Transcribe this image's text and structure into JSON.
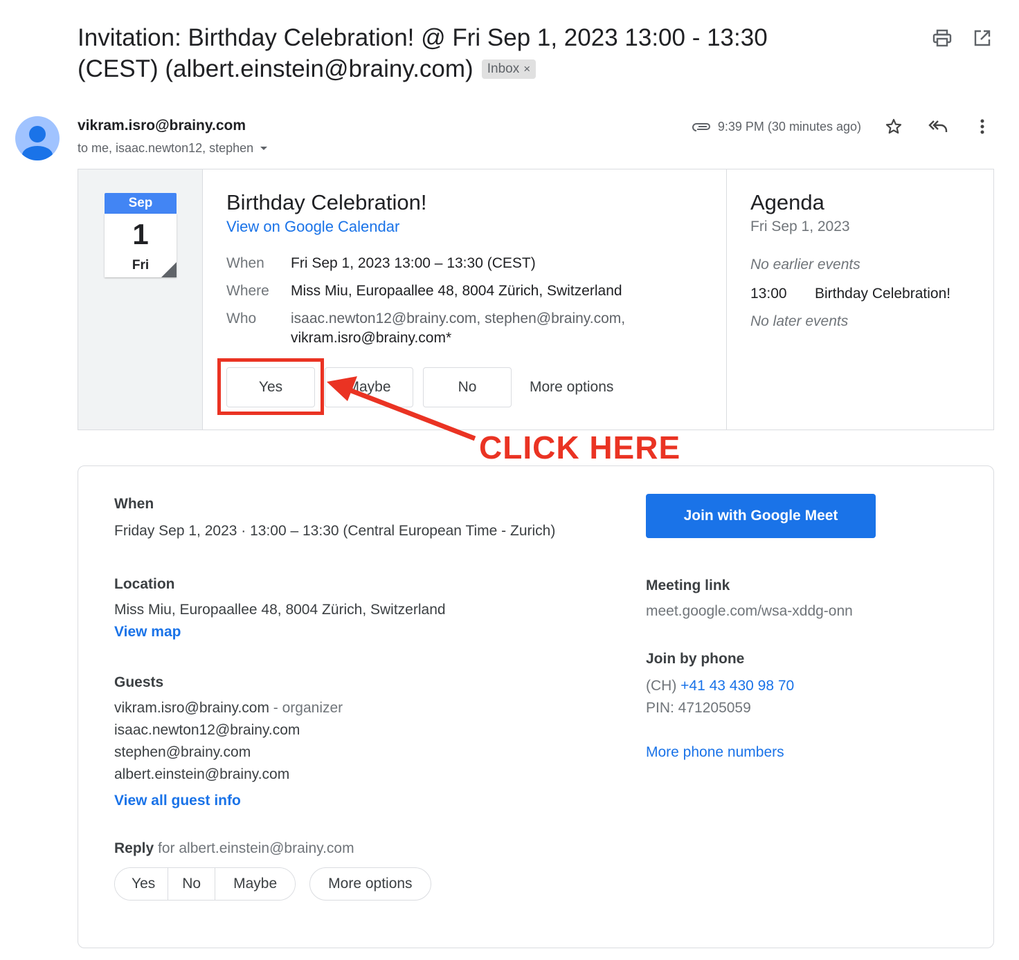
{
  "email": {
    "subject": "Invitation: Birthday Celebration! @ Fri Sep 1, 2023 13:00 - 13:30 (CEST) (albert.einstein@brainy.com)",
    "label": "Inbox",
    "label_close": "×",
    "sender": "vikram.isro@brainy.com",
    "recipients": "to me, isaac.newton12, stephen",
    "time": "9:39 PM (30 minutes ago)"
  },
  "invite": {
    "cal_month": "Sep",
    "cal_day": "1",
    "cal_dow": "Fri",
    "title": "Birthday Celebration!",
    "view_link": "View on Google Calendar",
    "when_label": "When",
    "when_value": "Fri Sep 1, 2023 13:00 – 13:30 (CEST)",
    "where_label": "Where",
    "where_value": "Miss Miu, Europaallee 48, 8004 Zürich, Switzerland",
    "who_label": "Who",
    "who_line1": "isaac.newton12@brainy.com, stephen@brainy.com,",
    "who_line2": "vikram.isro@brainy.com*",
    "rsvp": {
      "yes": "Yes",
      "maybe": "Maybe",
      "no": "No",
      "more": "More options"
    }
  },
  "agenda": {
    "title": "Agenda",
    "date": "Fri Sep 1, 2023",
    "no_earlier": "No earlier events",
    "event_time": "13:00",
    "event_title": "Birthday Celebration!",
    "no_later": "No later events"
  },
  "annotation": {
    "text": "CLICK HERE",
    "color": "#ea3323"
  },
  "description": {
    "when_heading": "When",
    "when_text": "Friday Sep 1, 2023 · 13:00 – 13:30 (Central European Time - Zurich)",
    "location_heading": "Location",
    "location_text": "Miss Miu, Europaallee 48, 8004 Zürich, Switzerland",
    "view_map": "View map",
    "guests_heading": "Guests",
    "guests": [
      {
        "email": "vikram.isro@brainy.com",
        "note": " - organizer"
      },
      {
        "email": "isaac.newton12@brainy.com",
        "note": ""
      },
      {
        "email": "stephen@brainy.com",
        "note": ""
      },
      {
        "email": "albert.einstein@brainy.com",
        "note": ""
      }
    ],
    "view_guest_info": "View all guest info",
    "reply_label": "Reply",
    "reply_for": " for albert.einstein@brainy.com",
    "reply_buttons": {
      "yes": "Yes",
      "no": "No",
      "maybe": "Maybe",
      "more": "More options"
    },
    "meet_button": "Join with Google Meet",
    "meeting_link_heading": "Meeting link",
    "meeting_link": "meet.google.com/wsa-xddg-onn",
    "join_phone_heading": "Join by phone",
    "phone_prefix": "(CH) ",
    "phone_number": "+41 43 430 98 70",
    "pin": "PIN: 471205059",
    "more_phones": "More phone numbers"
  },
  "colors": {
    "accent": "#1a73e8",
    "calendar_blue": "#4285f4",
    "annotation_red": "#ea3323"
  },
  "icons": [
    "print-icon",
    "open-in-new-icon",
    "attachment-icon",
    "star-icon",
    "reply-all-icon",
    "more-vert-icon",
    "dropdown-icon"
  ]
}
